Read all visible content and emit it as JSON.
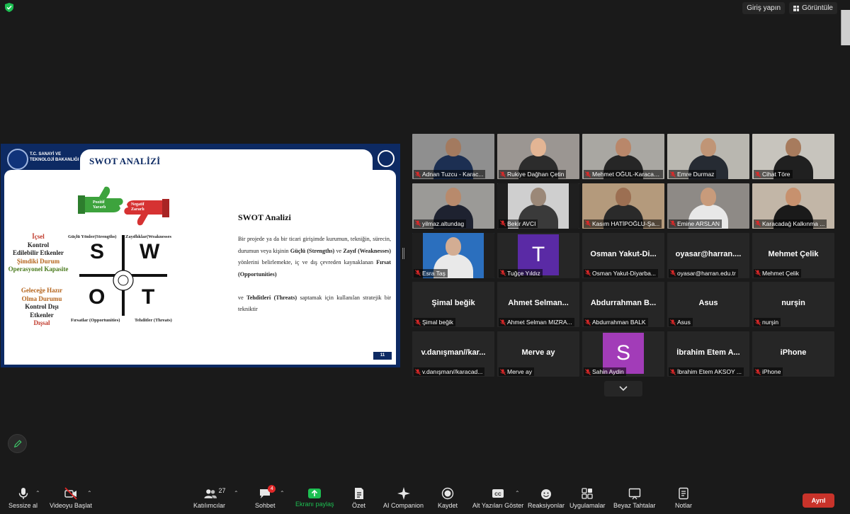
{
  "topbar": {
    "signin_label": "Giriş yapın",
    "view_label": "Görüntüle"
  },
  "slide": {
    "ministry_line1": "T.C. SANAYİ VE",
    "ministry_line2": "TEKNOLOJİ BAKANLIĞI",
    "title": "SWOT ANALİZİ",
    "page_number": "11",
    "thumb_positive_line1": "Pozitif",
    "thumb_positive_line2": "Yararlı",
    "thumb_negative_line1": "Negatif",
    "thumb_negative_line2": "Zararlı",
    "letters": {
      "s": "S",
      "w": "W",
      "o": "O",
      "t": "T"
    },
    "quadrants": {
      "strengths": "Güçlü Yönler(Strengths)",
      "weaknesses": "Zayıflıklar(Weaknesses",
      "opportunities": "Fırsatlar (Opportunities)",
      "threats": "Tehditler (Threats)"
    },
    "internal": {
      "line1": "İçsel",
      "line2": "Kontrol",
      "line3": "Edilebilir Etkenler",
      "line4": "Şimdiki Durum",
      "line5": "Operasyonel Kapasite"
    },
    "external": {
      "line1": "Geleceğe Hazır",
      "line2": "Olma Durumu",
      "line3": "Kontrol Dışı",
      "line4": "Etkenler",
      "line5": "Dışsal"
    },
    "heading": "SWOT Analizi",
    "body": {
      "p1": "Bir projede ya da bir ticari girişimde kurumun, tekniğin, sürecin, durumun veya kişinin",
      "strengths": "Güçlü (Strengths)",
      "and": "ve",
      "weaknesses": "Zayıf (Weaknesses)",
      "p2": "yönlerini belirlemekte, iç ve dış çevreden kaynaklanan",
      "opportunities": "Fırsat (Opportunities)",
      "p3": "ve",
      "threats": "Tehditleri (Threats)",
      "p4": "saptamak için kullanılan stratejik bir tekniktir"
    }
  },
  "participants": [
    {
      "name": "Adnan Tuzcu - Karac...",
      "type": "video",
      "bg": "#8f8f8f",
      "face": "#a37a5f",
      "body": "#1c2f52"
    },
    {
      "name": "Rukiye Dağhan Çetin",
      "type": "video",
      "bg": "#9b9692",
      "face": "#e3b594",
      "body": "#2c2c2c"
    },
    {
      "name": "Mehmet OĞUL-Karacad...",
      "type": "video",
      "bg": "#a9a7a2",
      "face": "#b9876a",
      "body": "#262626"
    },
    {
      "name": "Emre Durmaz",
      "type": "video",
      "bg": "#b9b7b0",
      "face": "#c09576",
      "body": "#262b33"
    },
    {
      "name": "Cihat Töre",
      "type": "video",
      "bg": "#c7c4bd",
      "face": "#a77b5d",
      "body": "#202020"
    },
    {
      "name": "yilmaz.altundag",
      "type": "video",
      "bg": "#9b9a97",
      "face": "#b88a6c",
      "body": "#1e2230"
    },
    {
      "name": "Bekir AVCI",
      "type": "video",
      "bg": "#cfcfcf",
      "face": "#9b8878",
      "body": "#3a3a3a"
    },
    {
      "name": "Kasım HATİPOĞLU-Şa...",
      "type": "video",
      "bg": "#b49a7c",
      "face": "#9c6f52",
      "body": "#2a2a2a"
    },
    {
      "name": "Emine ARSLAN",
      "type": "video",
      "bg": "#8e8a86",
      "face": "#c89b7b",
      "body": "#e8e8e8"
    },
    {
      "name": "Karacadağ Kalkınma ...",
      "type": "video",
      "bg": "#c2b6a7",
      "face": "#c7916e",
      "body": "#1a1a1a"
    },
    {
      "name": "Esra Taş",
      "type": "video",
      "bg": "#2b6fbe",
      "face": "#d3ad93",
      "body": "#e9e9e9"
    },
    {
      "name": "Tuğçe Yıldız",
      "type": "avatar",
      "letter": "T",
      "color": "#5a2aa5"
    },
    {
      "name": "Osman Yakut-Diyarba...",
      "type": "name",
      "display": "Osman  Yakut-Di..."
    },
    {
      "name": "oyasar@harran.edu.tr",
      "type": "name",
      "display": "oyasar@harran...."
    },
    {
      "name": "Mehmet Çelik",
      "type": "name",
      "display": "Mehmet Çelik"
    },
    {
      "name": "Şimal beğik",
      "type": "name",
      "display": "Şimal beğik"
    },
    {
      "name": "Ahmet Selman MIZRA...",
      "type": "name",
      "display": "Ahmet  Selman..."
    },
    {
      "name": "Abdurrahman BALK",
      "type": "name",
      "display": "Abdurrahman  B..."
    },
    {
      "name": "Asus",
      "type": "name",
      "display": "Asus"
    },
    {
      "name": "nurşin",
      "type": "name",
      "display": "nurşin"
    },
    {
      "name": "v.danışman//karacad...",
      "type": "name",
      "display": "v.danışman//kar..."
    },
    {
      "name": "Merve ay",
      "type": "name",
      "display": "Merve ay"
    },
    {
      "name": "Sahin Aydin",
      "type": "avatar",
      "letter": "S",
      "color": "#a23cb8"
    },
    {
      "name": "İbrahim Etem AKSOY ...",
      "type": "name",
      "display": "İbrahim  Etem  A..."
    },
    {
      "name": "iPhone",
      "type": "name",
      "display": "iPhone"
    }
  ],
  "toolbar": {
    "mute": "Sessize al",
    "video": "Videoyu Başlat",
    "participants": "Katılımcılar",
    "participants_count": "27",
    "chat": "Sohbet",
    "chat_badge": "4",
    "share": "Ekranı paylaş",
    "summary": "Özet",
    "companion": "AI Companion",
    "record": "Kaydet",
    "captions": "Alt Yazıları Göster",
    "reactions": "Reaksiyonlar",
    "apps": "Uygulamalar",
    "whiteboard": "Beyaz Tahtalar",
    "notes": "Notlar",
    "leave": "Ayrıl"
  },
  "colors": {
    "accent_green": "#1dbf52",
    "leave_red": "#c8332a",
    "slide_navy": "#0d2a63",
    "muted_red": "#e02828"
  }
}
